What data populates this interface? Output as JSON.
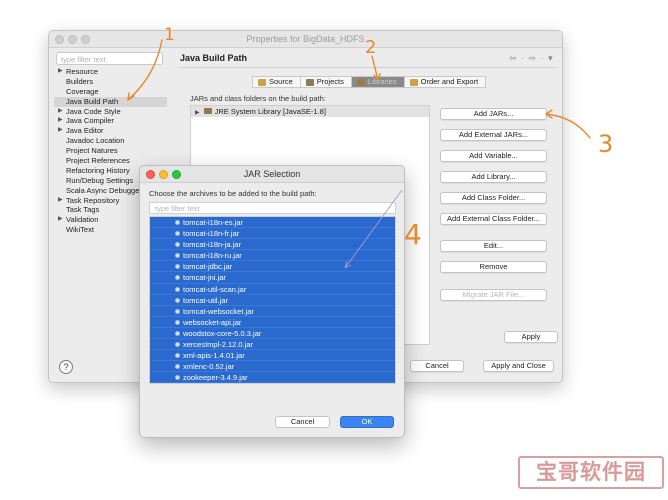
{
  "window": {
    "title": "Properties for BigData_HDFS",
    "filter_placeholder": "type filter text",
    "panel_title": "Java Build Path",
    "nav_arrows": "⇦ · ⇨ · ▾",
    "tree": [
      {
        "label": "Resource",
        "arrow": "▶"
      },
      {
        "label": "Builders",
        "arrow": ""
      },
      {
        "label": "Coverage",
        "arrow": ""
      },
      {
        "label": "Java Build Path",
        "arrow": "",
        "selected": true
      },
      {
        "label": "Java Code Style",
        "arrow": "▶"
      },
      {
        "label": "Java Compiler",
        "arrow": "▶"
      },
      {
        "label": "Java Editor",
        "arrow": "▶"
      },
      {
        "label": "Javadoc Location",
        "arrow": ""
      },
      {
        "label": "Project Natures",
        "arrow": ""
      },
      {
        "label": "Project References",
        "arrow": ""
      },
      {
        "label": "Refactoring History",
        "arrow": ""
      },
      {
        "label": "Run/Debug Settings",
        "arrow": ""
      },
      {
        "label": "Scala Async Debugge",
        "arrow": ""
      },
      {
        "label": "Task Repository",
        "arrow": "▶"
      },
      {
        "label": "Task Tags",
        "arrow": ""
      },
      {
        "label": "Validation",
        "arrow": "▶"
      },
      {
        "label": "WikiText",
        "arrow": ""
      }
    ],
    "tabs": [
      {
        "label": "Source",
        "color": "#c9a448"
      },
      {
        "label": "Projects",
        "color": "#8c7c5c"
      },
      {
        "label": "Libraries",
        "color": "#9c7a44",
        "active": true
      },
      {
        "label": "Order and Export",
        "color": "#d2a04a"
      }
    ],
    "jars_label": "JARs and class folders on the build path:",
    "jar_entry": "JRE System Library [JavaSE-1.8]",
    "buttons": {
      "add_jars": "Add JARs...",
      "add_external_jars": "Add External JARs...",
      "add_variable": "Add Variable...",
      "add_library": "Add Library...",
      "add_class_folder": "Add Class Folder...",
      "add_external_class_folder": "Add External Class Folder...",
      "edit": "Edit...",
      "remove": "Remove",
      "migrate": "Migrate JAR File...",
      "apply": "Apply",
      "cancel": "Cancel",
      "apply_close": "Apply and Close"
    },
    "help_symbol": "?"
  },
  "dialog": {
    "title": "JAR Selection",
    "message": "Choose the archives to be added to the build path:",
    "filter_placeholder": "type filter text",
    "items": [
      "tomcat-i18n-es.jar",
      "tomcat-i18n-fr.jar",
      "tomcat-i18n-ja.jar",
      "tomcat-i18n-ru.jar",
      "tomcat-jdbc.jar",
      "tomcat-jni.jar",
      "tomcat-util-scan.jar",
      "tomcat-util.jar",
      "tomcat-websocket.jar",
      "websocket-api.jar",
      "woodstox-core-5.0.3.jar",
      "xercesImpl-2.12.0.jar",
      "xml-apis-1.4.01.jar",
      "xmlenc-0.52.jar",
      "zookeeper-3.4.9.jar"
    ],
    "cancel": "Cancel",
    "ok": "OK"
  },
  "annotations": {
    "color": "#e58a2a",
    "step_1": "1",
    "step_2": "2",
    "step_3": "3",
    "step_4": "4"
  },
  "watermark": "宝哥软件园"
}
